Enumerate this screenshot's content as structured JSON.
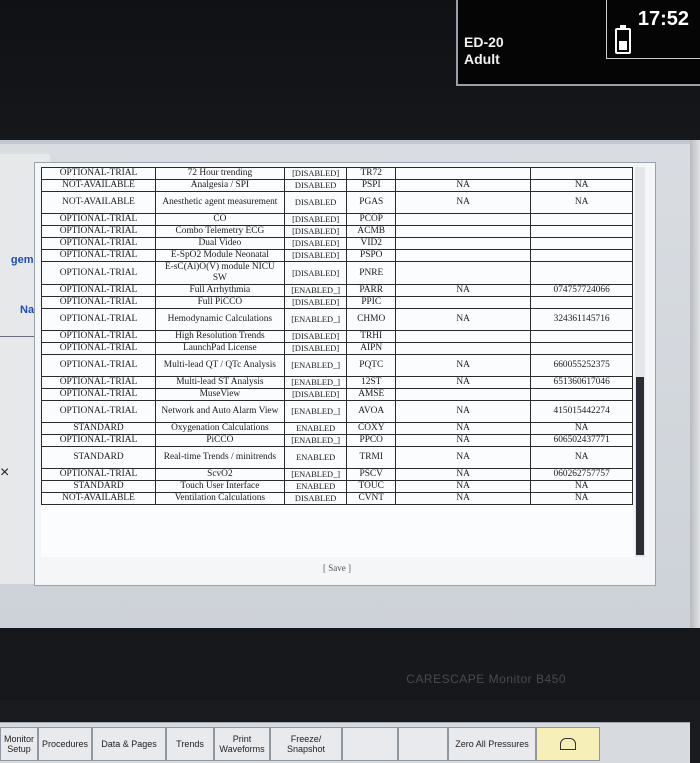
{
  "status": {
    "bed": "ED-20",
    "category": "Adult",
    "time": "17:52",
    "battery_level": 0.4
  },
  "left_panel": {
    "management_label": "gement",
    "name_label": "Name",
    "close_glyph": "×"
  },
  "rows": [
    {
      "status": "OPTIONAL-TRIAL",
      "option": "72 Hour trending",
      "state": "[DISABLED]",
      "code": "TR72",
      "info": "",
      "key": ""
    },
    {
      "status": "NOT-AVAILABLE",
      "option": "Analgesia / SPI",
      "state": "DISABLED",
      "code": "PSPI",
      "info": "NA",
      "key": "NA"
    },
    {
      "status": "NOT-AVAILABLE",
      "option": "Anesthetic agent measurement",
      "state": "DISABLED",
      "code": "PGAS",
      "info": "NA",
      "key": "NA"
    },
    {
      "status": "OPTIONAL-TRIAL",
      "option": "CO",
      "state": "[DISABLED]",
      "code": "PCOP",
      "info": "",
      "key": ""
    },
    {
      "status": "OPTIONAL-TRIAL",
      "option": "Combo Telemetry ECG",
      "state": "[DISABLED]",
      "code": "ACMB",
      "info": "",
      "key": ""
    },
    {
      "status": "OPTIONAL-TRIAL",
      "option": "Dual Video",
      "state": "[DISABLED]",
      "code": "VID2",
      "info": "",
      "key": ""
    },
    {
      "status": "OPTIONAL-TRIAL",
      "option": "E-SpO2 Module Neonatal",
      "state": "[DISABLED]",
      "code": "PSPO",
      "info": "",
      "key": ""
    },
    {
      "status": "OPTIONAL-TRIAL",
      "option": "E-sC(Ai)O(V) module NICU SW",
      "state": "[DISABLED]",
      "code": "PNRE",
      "info": "",
      "key": ""
    },
    {
      "status": "OPTIONAL-TRIAL",
      "option": "Full Arrhythmia",
      "state": "[ENABLED_]",
      "code": "PARR",
      "info": "NA",
      "key": "074757724066"
    },
    {
      "status": "OPTIONAL-TRIAL",
      "option": "Full PiCCO",
      "state": "[DISABLED]",
      "code": "PPIC",
      "info": "",
      "key": ""
    },
    {
      "status": "OPTIONAL-TRIAL",
      "option": "Hemodynamic Calculations",
      "state": "[ENABLED_]",
      "code": "CHMO",
      "info": "NA",
      "key": "324361145716"
    },
    {
      "status": "OPTIONAL-TRIAL",
      "option": "High Resolution Trends",
      "state": "[DISABLED]",
      "code": "TRHI",
      "info": "",
      "key": ""
    },
    {
      "status": "OPTIONAL-TRIAL",
      "option": "LaunchPad License",
      "state": "[DISABLED]",
      "code": "AIPN",
      "info": "",
      "key": ""
    },
    {
      "status": "OPTIONAL-TRIAL",
      "option": "Multi-lead QT / QTc Analysis",
      "state": "[ENABLED_]",
      "code": "PQTC",
      "info": "NA",
      "key": "660055252375"
    },
    {
      "status": "OPTIONAL-TRIAL",
      "option": "Multi-lead ST Analysis",
      "state": "[ENABLED_]",
      "code": "12ST",
      "info": "NA",
      "key": "651360617046"
    },
    {
      "status": "OPTIONAL-TRIAL",
      "option": "MuseView",
      "state": "[DISABLED]",
      "code": "AMSE",
      "info": "",
      "key": ""
    },
    {
      "status": "OPTIONAL-TRIAL",
      "option": "Network and Auto Alarm View",
      "state": "[ENABLED_]",
      "code": "AVOA",
      "info": "NA",
      "key": "415015442274"
    },
    {
      "status": "STANDARD",
      "option": "Oxygenation Calculations",
      "state": "ENABLED",
      "code": "COXY",
      "info": "NA",
      "key": "NA"
    },
    {
      "status": "OPTIONAL-TRIAL",
      "option": "PiCCO",
      "state": "[ENABLED_]",
      "code": "PPCO",
      "info": "NA",
      "key": "606502437771"
    },
    {
      "status": "STANDARD",
      "option": "Real-time Trends / minitrends",
      "state": "ENABLED",
      "code": "TRMI",
      "info": "NA",
      "key": "NA"
    },
    {
      "status": "OPTIONAL-TRIAL",
      "option": "ScvO2",
      "state": "[ENABLED_]",
      "code": "PSCV",
      "info": "NA",
      "key": "060262757757"
    },
    {
      "status": "STANDARD",
      "option": "Touch User Interface",
      "state": "ENABLED",
      "code": "TOUC",
      "info": "NA",
      "key": "NA"
    },
    {
      "status": "NOT-AVAILABLE",
      "option": "Ventilation Calculations",
      "state": "DISABLED",
      "code": "CVNT",
      "info": "NA",
      "key": "NA"
    }
  ],
  "save_label": "[ Save ]",
  "bottom_buttons": [
    {
      "label": "Monitor Setup",
      "name": "monitor-setup-button"
    },
    {
      "label": "Procedures",
      "name": "procedures-button"
    },
    {
      "label": "Data & Pages",
      "name": "data-pages-button"
    },
    {
      "label": "Trends",
      "name": "trends-button"
    },
    {
      "label": "Print Waveforms",
      "name": "print-waveforms-button"
    },
    {
      "label": "Freeze/ Snapshot",
      "name": "freeze-snapshot-button"
    },
    {
      "label": "",
      "name": "blank-button-1"
    },
    {
      "label": "",
      "name": "blank-button-2"
    },
    {
      "label": "Zero All Pressures",
      "name": "zero-all-pressures-button"
    },
    {
      "label": "",
      "name": "alarm-pause-button",
      "icon": "bell-icon"
    }
  ],
  "brand": "CARESCAPE Monitor B450",
  "colors": {
    "link_blue": "#1e4db7",
    "alarm_yellow": "#f6f0b8"
  }
}
